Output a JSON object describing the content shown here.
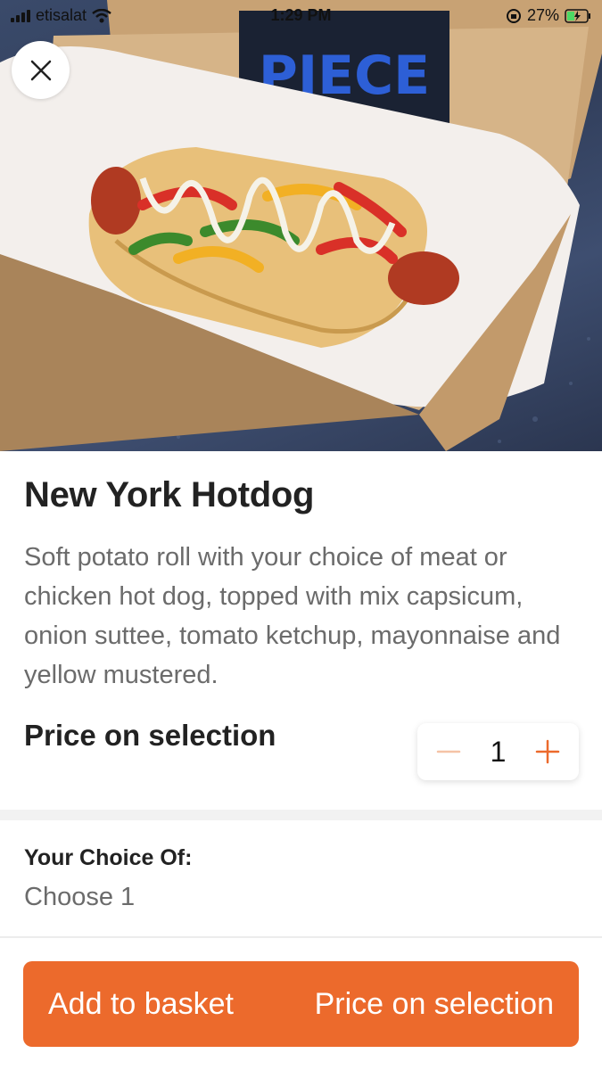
{
  "status_bar": {
    "carrier": "etisalat",
    "time": "1:29 PM",
    "battery": "27%"
  },
  "hero": {
    "image": "hotdog-in-box",
    "logo_text": "PIECE"
  },
  "close_button": {
    "icon": "close-icon"
  },
  "product": {
    "title": "New York Hotdog",
    "description": "Soft potato roll with your choice of meat or chicken hot dog, topped with mix capsicum, onion suttee, tomato ketchup, mayonnaise and yellow mustered.",
    "price_label": "Price on selection"
  },
  "quantity": {
    "value": "1",
    "minus_icon": "minus-icon",
    "plus_icon": "plus-icon"
  },
  "choice": {
    "title": "Your Choice Of:",
    "subtitle": "Choose 1"
  },
  "cta": {
    "label": "Add to basket",
    "price": "Price on selection"
  },
  "colors": {
    "accent": "#ec6a2c",
    "text_primary": "#222222",
    "text_secondary": "#6b6b6b"
  }
}
